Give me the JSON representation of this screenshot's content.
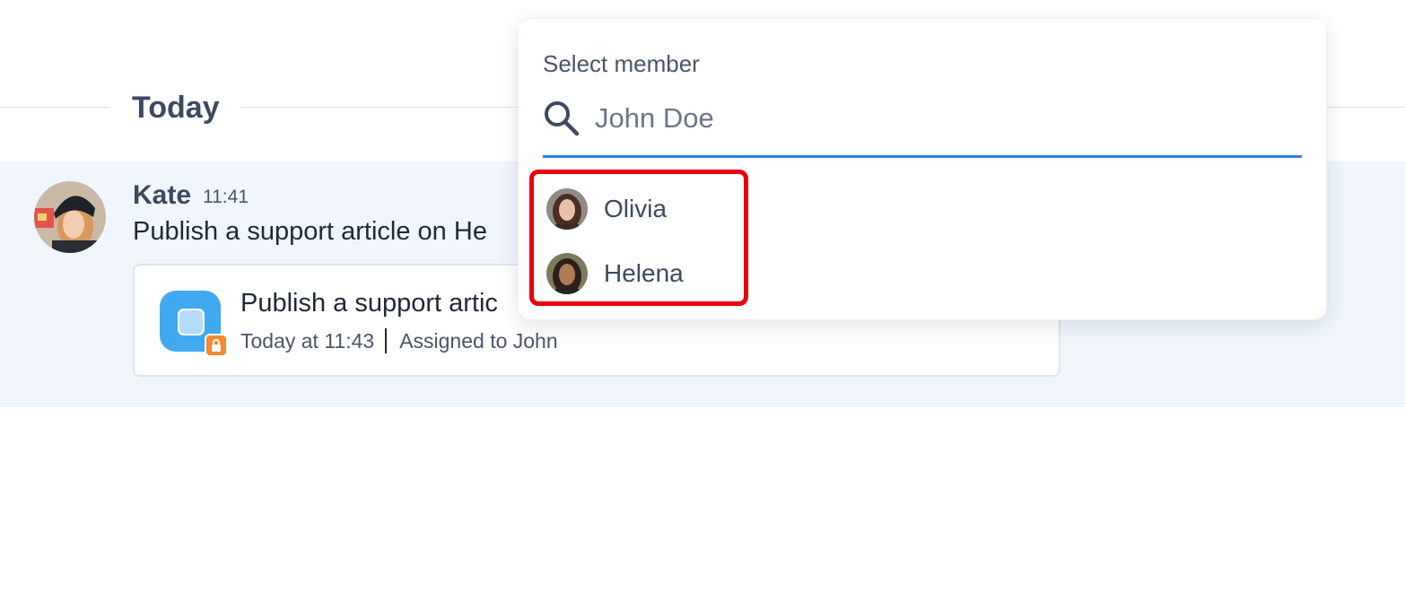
{
  "divider": {
    "label": "Today"
  },
  "message": {
    "author": "Kate",
    "time": "11:41",
    "text": "Publish a support article on He",
    "avatar_icon": "user-avatar-kate"
  },
  "task_card": {
    "title": "Publish a support artic",
    "timestamp": "Today at 11:43",
    "assignee": "Assigned to John",
    "icon": "task-icon",
    "badge_icon": "lock-icon",
    "icon_color": "#41a9f0",
    "badge_color": "#f6882f"
  },
  "member_picker": {
    "label": "Select member",
    "search": {
      "value": "",
      "placeholder": "John Doe",
      "icon": "search-icon"
    },
    "members": [
      {
        "name": "Olivia",
        "avatar_icon": "user-avatar-olivia"
      },
      {
        "name": "Helena",
        "avatar_icon": "user-avatar-helena"
      }
    ],
    "accent_color": "#2f80e8",
    "highlight_color": "#e8000b"
  }
}
